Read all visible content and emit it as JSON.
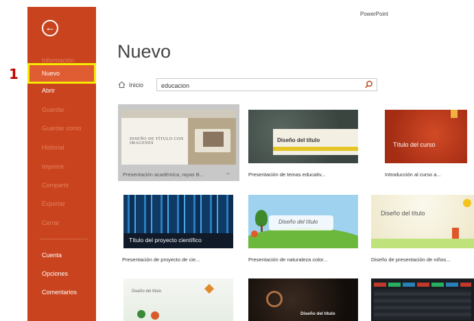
{
  "step_marker": "1",
  "app": {
    "title": "PowerPoint"
  },
  "sidebar": {
    "back_icon": "back-arrow-icon",
    "items": [
      {
        "label": "Información"
      },
      {
        "label": "Nuevo"
      },
      {
        "label": "Abrir"
      },
      {
        "label": "Guardar"
      },
      {
        "label": "Guardar como"
      },
      {
        "label": "Historial"
      },
      {
        "label": "Imprimir"
      },
      {
        "label": "Compartir"
      },
      {
        "label": "Exportar"
      },
      {
        "label": "Cerrar"
      },
      {
        "label": "Cuenta"
      },
      {
        "label": "Opciones"
      },
      {
        "label": "Comentarios"
      }
    ],
    "selected": "Nuevo",
    "colors": {
      "background": "#c9441e",
      "selected": "#e05c32",
      "highlight_box": "#f4eb00"
    }
  },
  "main": {
    "title": "Nuevo",
    "home_label": "Inicio",
    "home_icon": "home-icon",
    "search": {
      "value": "educacion",
      "icon": "search-icon"
    }
  },
  "templates": [
    {
      "caption": "Presentación académica, rayas B...",
      "thumb_title": "DISEÑO DE TÍTULO CON IMAGENES"
    },
    {
      "caption": "Presentación de temas educativ...",
      "thumb_title": "Diseño del título"
    },
    {
      "caption": "Introducción al curso a...",
      "thumb_title": "Título del curso"
    },
    {
      "caption": "Presentación de proyecto de cie...",
      "thumb_title": "Título del proyecto científico"
    },
    {
      "caption": "Presentación de naturaleza color...",
      "thumb_title": "Diseño del título"
    },
    {
      "caption": "Diseño de presentación de niños...",
      "thumb_title": "Diseño del título"
    },
    {
      "caption": "",
      "thumb_title": "Diseño del título"
    },
    {
      "caption": "",
      "thumb_title": "Diseño del título"
    },
    {
      "caption": "",
      "thumb_title": ""
    }
  ]
}
